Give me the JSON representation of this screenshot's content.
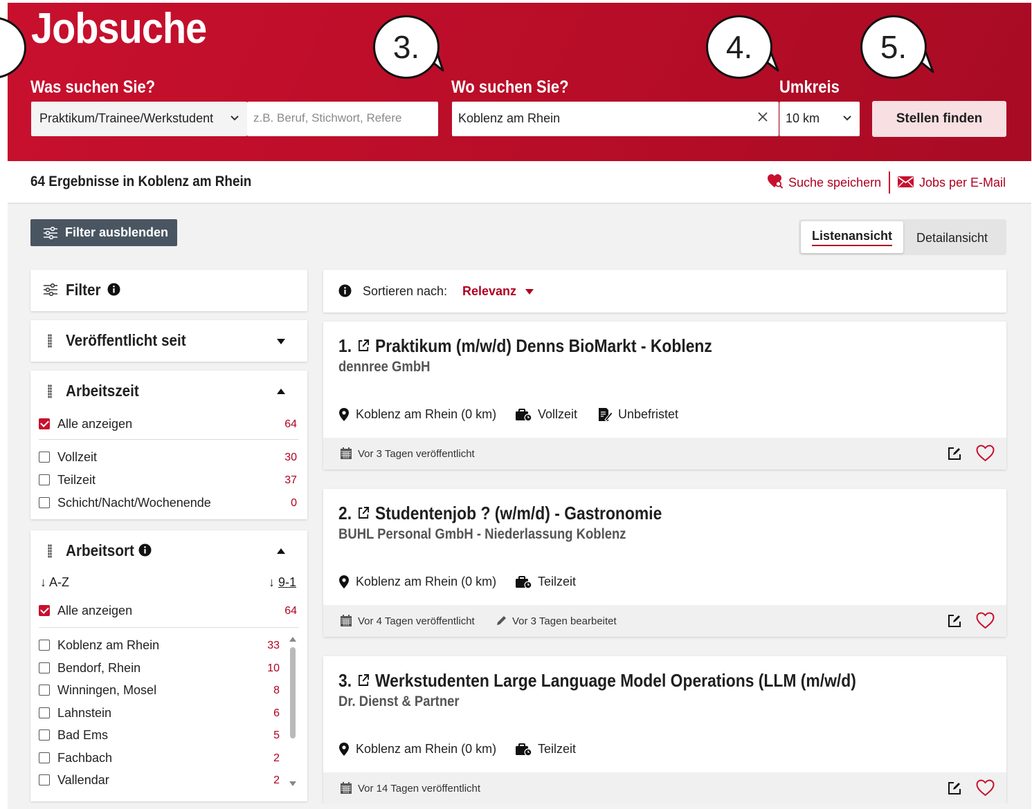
{
  "header": {
    "title": "Jobsuche",
    "label_what": "Was suchen Sie?",
    "label_where": "Wo suchen Sie?",
    "label_radius": "Umkreis",
    "category_value": "Praktikum/Trainee/Werkstudent",
    "keyword_placeholder": "z.B. Beruf, Stichwort, Refere",
    "location_value": "Koblenz am Rhein",
    "radius_value": "10 km",
    "search_button": "Stellen finden",
    "callouts": [
      "3.",
      "4.",
      "5."
    ]
  },
  "results": {
    "count_text": "64 Ergebnisse in Koblenz am Rhein",
    "save_search": "Suche speichern",
    "jobs_by_email": "Jobs per E-Mail"
  },
  "toolbar": {
    "filter_toggle": "Filter ausblenden",
    "view_list": "Listenansicht",
    "view_detail": "Detailansicht"
  },
  "filter": {
    "title": "Filter",
    "published": {
      "title": "Veröffentlicht seit"
    },
    "worktime": {
      "title": "Arbeitszeit",
      "all": {
        "label": "Alle anzeigen",
        "count": "64"
      },
      "options": [
        {
          "label": "Vollzeit",
          "count": "30"
        },
        {
          "label": "Teilzeit",
          "count": "37"
        },
        {
          "label": "Schicht/Nacht/Wochenende",
          "count": "0"
        }
      ]
    },
    "location": {
      "title": "Arbeitsort",
      "sort_az": "A-Z",
      "sort_91": "9-1",
      "all": {
        "label": "Alle anzeigen",
        "count": "64"
      },
      "options": [
        {
          "label": "Koblenz am Rhein",
          "count": "33"
        },
        {
          "label": "Bendorf, Rhein",
          "count": "10"
        },
        {
          "label": "Winningen, Mosel",
          "count": "8"
        },
        {
          "label": "Lahnstein",
          "count": "6"
        },
        {
          "label": "Bad Ems",
          "count": "5"
        },
        {
          "label": "Fachbach",
          "count": "2"
        },
        {
          "label": "Vallendar",
          "count": "2"
        }
      ]
    }
  },
  "sort": {
    "label": "Sortieren nach:",
    "value": "Relevanz"
  },
  "jobs": [
    {
      "index": "1.",
      "title": "Praktikum (m/w/d) Denns BioMarkt - Koblenz",
      "company": "dennree GmbH",
      "location": "Koblenz am Rhein (0 km)",
      "worktime": "Vollzeit",
      "contract": "Unbefristet",
      "published": "Vor 3 Tagen veröffentlicht",
      "edited": ""
    },
    {
      "index": "2.",
      "title": "Studentenjob ? (w/m/d) - Gastronomie",
      "company": "BUHL Personal GmbH - Niederlassung Koblenz",
      "location": "Koblenz am Rhein (0 km)",
      "worktime": "Teilzeit",
      "contract": "",
      "published": "Vor 4 Tagen veröffentlicht",
      "edited": "Vor 3 Tagen bearbeitet"
    },
    {
      "index": "3.",
      "title": "Werkstudenten Large Language Model Operations (LLM (m/w/d)",
      "company": "Dr. Dienst & Partner",
      "location": "Koblenz am Rhein (0 km)",
      "worktime": "Teilzeit",
      "contract": "",
      "published": "Vor 14 Tagen veröffentlicht",
      "edited": ""
    }
  ],
  "colors": {
    "brand_red": "#c8102e",
    "count_red": "#b00020",
    "filter_button": "#4a5562"
  }
}
